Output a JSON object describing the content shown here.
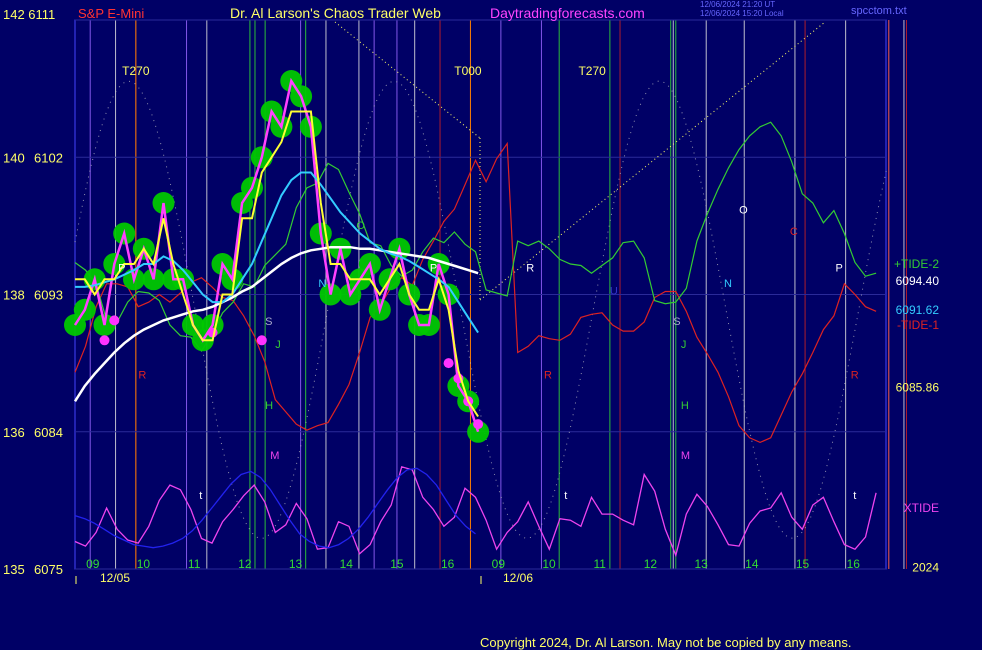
{
  "header": {
    "left_price_top": "142  6111",
    "instrument": "S&P E-Mini",
    "title": "Dr. Al Larson's Chaos Trader Web",
    "site": "Daytradingforecasts.com",
    "stamp_line1": "12/06/2024 21:20 UT",
    "stamp_line2": "12/06/2024 15:20 Local",
    "file": "spcctom.txt"
  },
  "footer": {
    "copyright": "Copyright 2024, Dr. Al Larson. May not be copied by any means."
  },
  "colors": {
    "background": "#000066",
    "plot_border": "#4444ff",
    "grid": "#2a2a99",
    "price_dots": "#00c800",
    "price_line": "#ff40ff",
    "fast_avg": "#ffff33",
    "mid_avg": "#33ccff",
    "slow_avg": "#ffffff",
    "tide_plus2": "#33cc33",
    "tide_minus1": "#dd2222",
    "xtide": "#ee44ee",
    "blue_curve": "#2222ee"
  },
  "chart_data": {
    "type": "line",
    "title": "S&P E-Mini",
    "subtitle": "Dr. Al Larson's Chaos Trader Web",
    "ylim": [
      6075,
      6111
    ],
    "left_axis_labels": [
      {
        "left": "142",
        "right": "6111",
        "price": 6111
      },
      {
        "left": "140",
        "right": "6102",
        "price": 6102
      },
      {
        "left": "138",
        "right": "6093",
        "price": 6093
      },
      {
        "left": "136",
        "right": "6084",
        "price": 6084
      },
      {
        "left": "135",
        "right": "6075",
        "price": 6075
      }
    ],
    "x_hours": [
      "09",
      "10",
      "11",
      "12",
      "13",
      "14",
      "15",
      "16",
      "09",
      "10",
      "11",
      "12",
      "13",
      "14",
      "15",
      "16"
    ],
    "x_dates": [
      "12/05",
      "12/06"
    ],
    "hours_index": [
      0,
      1,
      2,
      3,
      4,
      5,
      6,
      7,
      8,
      9,
      10,
      11,
      12,
      13,
      14,
      15
    ],
    "price_values": [
      6091,
      6092,
      6094,
      6091,
      6095,
      6097,
      6094,
      6096,
      6094,
      6099,
      6094,
      6094,
      6091,
      6090,
      6091,
      6095,
      6094,
      6099,
      6100,
      6102,
      6105,
      6104,
      6107,
      6106,
      6104,
      6097,
      6093,
      6096,
      6093,
      6094,
      6095,
      6092,
      6094,
      6096,
      6093,
      6091,
      6091,
      6095,
      6093,
      6087,
      6086,
      6084
    ],
    "fast_avg": [
      6094,
      6094,
      6093,
      6094,
      6094,
      6095,
      6095,
      6096,
      6095,
      6098,
      6095,
      6093,
      6091,
      6090,
      6090,
      6093,
      6093,
      6098,
      6098,
      6101,
      6102,
      6103,
      6105,
      6105,
      6105,
      6099,
      6095,
      6095,
      6094,
      6094,
      6094,
      6093,
      6094,
      6095,
      6093,
      6092,
      6092,
      6094,
      6092,
      6088,
      6086,
      6085
    ],
    "mid_avg": [
      6093.5,
      6093.5,
      6093.6,
      6093.8,
      6094,
      6094.3,
      6094.6,
      6095,
      6095,
      6095.5,
      6095.2,
      6094.6,
      6093.8,
      6093,
      6092.5,
      6092.5,
      6093,
      6094,
      6095,
      6096.5,
      6098,
      6099.5,
      6100.5,
      6101,
      6101,
      6100.2,
      6099.3,
      6098.4,
      6097.7,
      6097,
      6096.5,
      6096,
      6095.7,
      6095.5,
      6095.2,
      6094.8,
      6094.4,
      6094,
      6093.5,
      6092.5,
      6091.5,
      6090.5
    ],
    "slow_avg": [
      6086,
      6087,
      6087.8,
      6088.5,
      6089.2,
      6089.8,
      6090.3,
      6090.7,
      6091,
      6091.3,
      6091.5,
      6091.7,
      6091.9,
      6092,
      6092.2,
      6092.5,
      6092.8,
      6093.2,
      6093.5,
      6094,
      6094.5,
      6095,
      6095.4,
      6095.7,
      6095.9,
      6096,
      6096.1,
      6096.1,
      6096.1,
      6096,
      6096,
      6095.9,
      6095.8,
      6095.7,
      6095.6,
      6095.5,
      6095.4,
      6095.2,
      6095,
      6094.8,
      6094.6,
      6094.4
    ],
    "tide_plus2": [
      6095.1,
      6094.6,
      6093.7,
      6091.3,
      6091.2,
      6092.5,
      6093.2,
      6093.1,
      6092.6,
      6091.0,
      6090.3,
      6090.2,
      6089.3,
      6090.4,
      6091.8,
      6092.5,
      6093.7,
      6093.5,
      6094.9,
      6095.6,
      6096.3,
      6098.7,
      6100.0,
      6100.3,
      6101.6,
      6101.2,
      6099.7,
      6098.3,
      6096.4,
      6096.2,
      6094.9,
      6094.2,
      6094.6,
      6095.8,
      6096.7,
      6096.4,
      6097.1,
      6096.3,
      6095.8,
      6093.3,
      6093.1,
      6092.9,
      6096.5,
      6096.2,
      6096.5,
      6096.0,
      6095.3,
      6095.0,
      6094.9,
      6094.4,
      6094.9,
      6095.4,
      6096.4,
      6096.5,
      6095.4,
      6092.6,
      6092.4,
      6092.5,
      6093.4,
      6096.5,
      6098.3,
      6099.9,
      6101.3,
      6102.5,
      6103.4,
      6104.0,
      6104.3,
      6103.4,
      6101.7,
      6099.6,
      6099.0,
      6097.7,
      6098.5,
      6097.0,
      6095.1,
      6094.2,
      6094.4
    ],
    "tide_minus1": [
      6087.9,
      6089.6,
      6092.2,
      6093.7,
      6093.7,
      6093.5,
      6092.2,
      6092.5,
      6093.0,
      6092.5,
      6093.1,
      6093.8,
      6094.1,
      6093.5,
      6092.8,
      6092.6,
      6091.6,
      6090.3,
      6088.6,
      6086.1,
      6085.3,
      6084.5,
      6084.1,
      6084.4,
      6084.6,
      6085.8,
      6087.1,
      6089.2,
      6091.5,
      6092.3,
      6093.5,
      6094.1,
      6093.6,
      6095.3,
      6096.5,
      6097.8,
      6098.6,
      6100.2,
      6101.8,
      6100.4,
      6101.9,
      6102.9,
      6089.2,
      6089.6,
      6090.3,
      6090.1,
      6090.0,
      6090.4,
      6091.5,
      6091.7,
      6091.8,
      6091.0,
      6090.6,
      6090.6,
      6091.2,
      6092.8,
      6093.2,
      6093.2,
      6091.9,
      6090.2,
      6089.1,
      6087.9,
      6086.3,
      6084.4,
      6083.6,
      6083.3,
      6083.6,
      6085.1,
      6086.6,
      6087.8,
      6089.2,
      6090.7,
      6091.6,
      6093.7,
      6093.0,
      6092.2,
      6091.9
    ],
    "xtide": [
      6076.8,
      6076.5,
      6077.4,
      6079.0,
      6077.6,
      6076.9,
      6076.7,
      6077.8,
      6079.5,
      6080.5,
      6080.2,
      6078.9,
      6077.0,
      6076.7,
      6078.1,
      6078.9,
      6079.8,
      6080.5,
      6079.4,
      6077.4,
      6077.9,
      6079.3,
      6078.3,
      6076.3,
      6076.4,
      6078.1,
      6077.8,
      6076.0,
      6076.6,
      6078.1,
      6079.2,
      6081.7,
      6081.5,
      6079.7,
      6078.9,
      6077.8,
      6078.4,
      6080.3,
      6079.7,
      6078.2,
      6076.3,
      6077.4,
      6078.1,
      6079.4,
      6077.8,
      6076.3,
      6078.3,
      6078.2,
      6077.8,
      6079.7,
      6078.6,
      6078.6,
      6078.2,
      6077.9,
      6081.2,
      6080.1,
      6077.6,
      6075.9,
      6078.6,
      6079.9,
      6079.1,
      6077.9,
      6076.6,
      6076.5,
      6078.0,
      6078.8,
      6079.0,
      6080.0,
      6078.4,
      6077.6,
      6079.2,
      6079.7,
      6078.1,
      6076.6,
      6076.3,
      6077.1,
      6080.0
    ],
    "blue_curve": [
      6078.5,
      6078.3,
      6078.0,
      6077.6,
      6077.2,
      6076.9,
      6076.6,
      6076.5,
      6076.4,
      6076.5,
      6076.7,
      6077.0,
      6077.5,
      6078.2,
      6079.0,
      6079.8,
      6080.6,
      6081.2,
      6081.4,
      6081.0,
      6080.2,
      6079.2,
      6078.2,
      6077.3,
      6076.8,
      6076.5,
      6076.4,
      6076.6,
      6077.0,
      6077.6,
      6078.4,
      6079.3,
      6080.2,
      6081.0,
      6081.5,
      6081.6,
      6081.2,
      6080.5,
      6079.5,
      6078.5,
      6077.8,
      6077.3
    ],
    "right_labels": [
      {
        "text": "+TIDE-2",
        "color": "#33cc33",
        "price": 6095.0
      },
      {
        "text": "6094.40",
        "color": "#ffffff",
        "price": 6093.9
      },
      {
        "text": "6091.62",
        "color": "#33ccff",
        "price": 6092.0
      },
      {
        "text": "-TIDE-1",
        "color": "#dd2222",
        "price": 6091.0
      },
      {
        "text": "6085.86",
        "color": "#ffff66",
        "price": 6086.9
      },
      {
        "text": "XTIDE",
        "color": "#ee44ee",
        "price": 6079.0
      },
      {
        "text": "2024",
        "color": "#ffff66",
        "price": 6075.1
      }
    ],
    "top_labels": [
      {
        "text": "T270",
        "at": 1.2
      },
      {
        "text": "T000",
        "at": 7.75
      },
      {
        "text": "T270",
        "at": 10.2
      }
    ],
    "vertical_lines": {
      "white": [
        0.8,
        2.6,
        4.95,
        5.6,
        6.7,
        11.8,
        12.45,
        13.2,
        14.2,
        15.2,
        16.05,
        16.35
      ],
      "green": [
        3.45,
        3.55,
        3.75,
        4.55,
        9.55,
        10.55,
        11.75,
        11.85
      ],
      "red": [
        1.2,
        7.2,
        7.8,
        10.75,
        14.4,
        16.05,
        16.4
      ],
      "orange": [
        1.2,
        7.8
      ],
      "purple": [
        0.3,
        2.2,
        4.45,
        5.9,
        6.35,
        8.4,
        9.2
      ]
    },
    "markers": [
      {
        "text": "P",
        "color": "#ffffff",
        "h": 0.85,
        "price": 6094.5
      },
      {
        "text": "R",
        "color": "#dd2222",
        "h": 1.25,
        "price": 6087.5
      },
      {
        "text": "S",
        "color": "#aaaacc",
        "h": 3.75,
        "price": 6091.0
      },
      {
        "text": "J",
        "color": "#33cc33",
        "h": 3.95,
        "price": 6089.5
      },
      {
        "text": "H",
        "color": "#33cc33",
        "h": 3.75,
        "price": 6085.5
      },
      {
        "text": "M",
        "color": "#ee44ee",
        "h": 3.85,
        "price": 6082.2
      },
      {
        "text": "t",
        "color": "#ffffff",
        "h": 2.45,
        "price": 6079.6
      },
      {
        "text": "N",
        "color": "#33ccff",
        "h": 4.8,
        "price": 6093.5
      },
      {
        "text": "O",
        "color": "#33cc33",
        "h": 5.55,
        "price": 6097.3
      },
      {
        "text": "P",
        "color": "#ffffff",
        "h": 7.0,
        "price": 6094.5
      },
      {
        "text": "R",
        "color": "#ffffff",
        "h": 8.9,
        "price": 6094.5
      },
      {
        "text": "R",
        "color": "#dd2222",
        "h": 9.25,
        "price": 6087.5
      },
      {
        "text": "U",
        "color": "#3333cc",
        "h": 10.55,
        "price": 6093.0
      },
      {
        "text": "t",
        "color": "#ffffff",
        "h": 9.65,
        "price": 6079.6
      },
      {
        "text": "S",
        "color": "#aaaacc",
        "h": 11.8,
        "price": 6091.0
      },
      {
        "text": "J",
        "color": "#33cc33",
        "h": 11.95,
        "price": 6089.5
      },
      {
        "text": "H",
        "color": "#33cc33",
        "h": 11.95,
        "price": 6085.5
      },
      {
        "text": "M",
        "color": "#ee44ee",
        "h": 11.95,
        "price": 6082.2
      },
      {
        "text": "N",
        "color": "#33ccff",
        "h": 12.8,
        "price": 6093.5
      },
      {
        "text": "O",
        "color": "#ffffff",
        "h": 13.1,
        "price": 6098.3
      },
      {
        "text": "C",
        "color": "#dd2222",
        "h": 14.1,
        "price": 6096.9
      },
      {
        "text": "P",
        "color": "#ffffff",
        "h": 15.0,
        "price": 6094.5
      },
      {
        "text": "R",
        "color": "#dd2222",
        "h": 15.3,
        "price": 6087.5
      },
      {
        "text": "t",
        "color": "#ffffff",
        "h": 15.35,
        "price": 6079.6
      }
    ]
  }
}
